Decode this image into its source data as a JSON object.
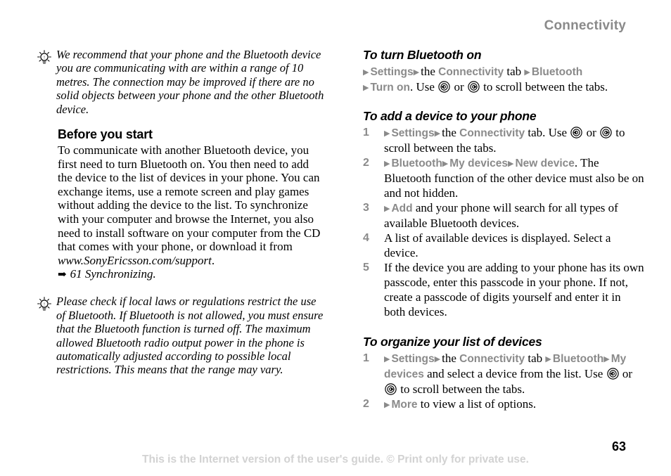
{
  "header": {
    "chapter_title": "Connectivity"
  },
  "footer": {
    "note": "This is the Internet version of the user's guide. © Print only for private use.",
    "page_number": "63"
  },
  "icons": {
    "tip": "lightbulb-icon",
    "navkey_left": "navigation-key-left-icon",
    "navkey_right": "navigation-key-right-icon",
    "menu_arrow": "triangle-right-icon",
    "crossref_arrow": "right-arrow-icon"
  },
  "left_column": {
    "tip_range": {
      "icon": "lightbulb-icon",
      "text": "We recommend that your phone and the Bluetooth device you are communicating with are within a range of 10 metres. The connection may be improved if there are no solid objects between your phone and the other Bluetooth device."
    },
    "before_you_start": {
      "heading": "Before you start",
      "paragraph": "To communicate with another Bluetooth device, you first need to turn Bluetooth on. You then need to add the device to the list of devices in your phone. You can exchange items, use a remote screen and play games without adding the device to the list. To synchronize with your computer and browse the Internet, you also need to install software on your computer from the CD that comes with your phone, or download it from ",
      "url": "www.SonyEricsson.com/support",
      "paragraph_end": ".",
      "crossref": {
        "arrow": "➡",
        "text": "61 Synchronizing."
      }
    },
    "tip_laws": {
      "icon": "lightbulb-icon",
      "text": "Please check if local laws or regulations restrict the use of Bluetooth. If Bluetooth is not allowed, you must ensure that the Bluetooth function is turned off. The maximum allowed Bluetooth radio output power in the phone is automatically adjusted according to possible local restrictions. This means that the range may vary."
    }
  },
  "right_column": {
    "turn_on": {
      "heading": "To turn Bluetooth on",
      "line1": [
        {
          "type": "tri"
        },
        {
          "type": "menu",
          "text": "Settings"
        },
        {
          "type": "tri"
        },
        {
          "type": "plain",
          "text": "the "
        },
        {
          "type": "menu",
          "text": "Connectivity"
        },
        {
          "type": "plain",
          "text": " tab "
        },
        {
          "type": "tri"
        },
        {
          "type": "menu",
          "text": "Bluetooth"
        }
      ],
      "line2": [
        {
          "type": "tri"
        },
        {
          "type": "menu",
          "text": "Turn on"
        },
        {
          "type": "plain",
          "text": ". Use "
        },
        {
          "type": "navkey-left"
        },
        {
          "type": "plain",
          "text": " or "
        },
        {
          "type": "navkey-right"
        },
        {
          "type": "plain",
          "text": " to scroll between the tabs."
        }
      ]
    },
    "add_device": {
      "heading": "To add a device to your phone",
      "steps": [
        {
          "num": "1",
          "parts": [
            {
              "type": "tri"
            },
            {
              "type": "menu",
              "text": "Settings"
            },
            {
              "type": "tri"
            },
            {
              "type": "plain",
              "text": "the "
            },
            {
              "type": "menu",
              "text": "Connectivity"
            },
            {
              "type": "plain",
              "text": " tab. Use "
            },
            {
              "type": "navkey-left"
            },
            {
              "type": "plain",
              "text": " or "
            },
            {
              "type": "navkey-right"
            },
            {
              "type": "plain",
              "text": " to scroll between the tabs."
            }
          ]
        },
        {
          "num": "2",
          "parts": [
            {
              "type": "tri"
            },
            {
              "type": "menu",
              "text": "Bluetooth"
            },
            {
              "type": "tri"
            },
            {
              "type": "menu",
              "text": "My devices"
            },
            {
              "type": "tri"
            },
            {
              "type": "menu",
              "text": "New device"
            },
            {
              "type": "plain",
              "text": ". The Bluetooth function of the other device must also be on and not hidden."
            }
          ]
        },
        {
          "num": "3",
          "parts": [
            {
              "type": "tri"
            },
            {
              "type": "menu",
              "text": "Add"
            },
            {
              "type": "plain",
              "text": " and your phone will search for all types of available Bluetooth devices."
            }
          ]
        },
        {
          "num": "4",
          "parts": [
            {
              "type": "plain",
              "text": "A list of available devices is displayed. Select a device."
            }
          ]
        },
        {
          "num": "5",
          "parts": [
            {
              "type": "plain",
              "text": "If the device you are adding to your phone has its own passcode, enter this passcode in your phone. If not, create a passcode of digits yourself and enter it in both devices."
            }
          ]
        }
      ]
    },
    "organize": {
      "heading": "To organize your list of devices",
      "steps": [
        {
          "num": "1",
          "parts": [
            {
              "type": "tri"
            },
            {
              "type": "menu",
              "text": "Settings"
            },
            {
              "type": "tri"
            },
            {
              "type": "plain",
              "text": "the "
            },
            {
              "type": "menu",
              "text": "Connectivity"
            },
            {
              "type": "plain",
              "text": " tab "
            },
            {
              "type": "tri"
            },
            {
              "type": "menu",
              "text": "Bluetooth"
            },
            {
              "type": "tri"
            },
            {
              "type": "menu",
              "text": "My devices"
            },
            {
              "type": "plain",
              "text": " and select a device from the list. Use "
            },
            {
              "type": "navkey-left"
            },
            {
              "type": "plain",
              "text": " or "
            },
            {
              "type": "navkey-right"
            },
            {
              "type": "plain",
              "text": " to scroll between the tabs."
            }
          ]
        },
        {
          "num": "2",
          "parts": [
            {
              "type": "tri"
            },
            {
              "type": "menu",
              "text": "More"
            },
            {
              "type": "plain",
              "text": " to view a list of options."
            }
          ]
        }
      ]
    }
  }
}
